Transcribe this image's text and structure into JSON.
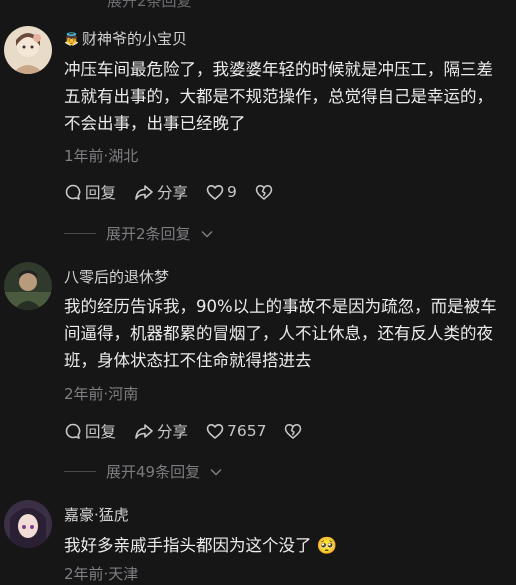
{
  "top_cut": "展开2条回复",
  "comments": [
    {
      "username": "财神爷的小宝贝",
      "text": "冲压车间最危险了，我婆婆年轻的时候就是冲压工，隔三差五就有出事的，大都是不规范操作，总觉得自己是幸运的，不会出事，出事已经晚了",
      "meta": "1年前·湖北",
      "reply_label": "回复",
      "share_label": "分享",
      "likes": "9",
      "expand_label": "展开2条回复"
    },
    {
      "username": "八零后的退休梦",
      "text": "我的经历告诉我，90%以上的事故不是因为疏忽，而是被车间逼得，机器都累的冒烟了，人不让休息，还有反人类的夜班，身体状态扛不住命就得搭进去",
      "meta": "2年前·河南",
      "reply_label": "回复",
      "share_label": "分享",
      "likes": "7657",
      "expand_label": "展开49条回复"
    },
    {
      "username": "嘉豪·猛虎",
      "text": "我好多亲戚手指头都因为这个没了",
      "emoji": "🥺",
      "meta": "2年前·天津"
    }
  ]
}
